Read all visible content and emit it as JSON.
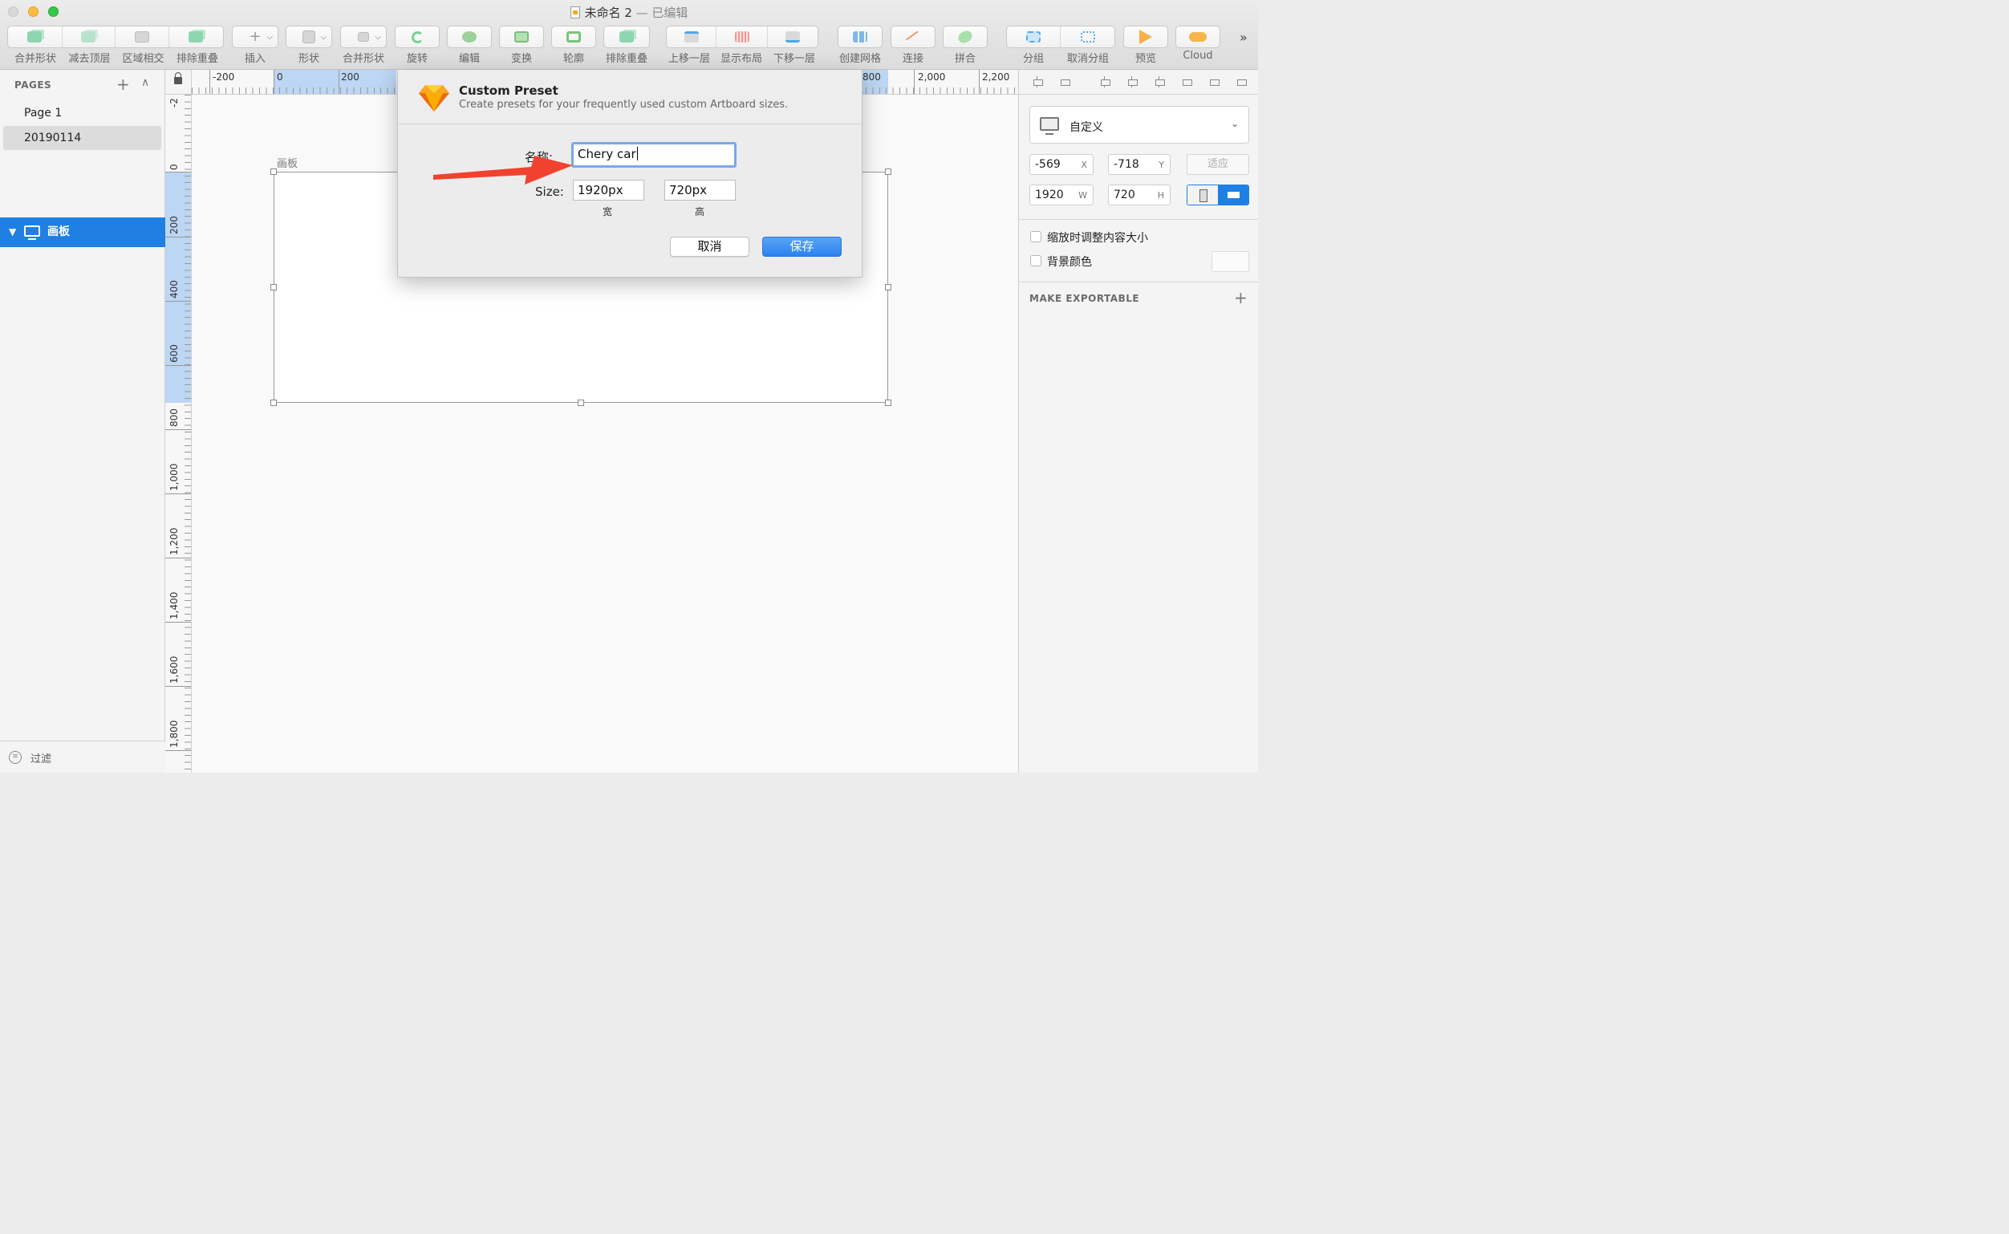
{
  "window": {
    "title": "未命名 2",
    "title_suffix": "— 已编辑"
  },
  "toolbar": {
    "labels": [
      "合并形状",
      "减去顶层",
      "区域相交",
      "排除重叠",
      "插入",
      "形状",
      "合并形状",
      "旋转",
      "编辑",
      "变换",
      "轮廓",
      "排除重叠",
      "上移一层",
      "显示布局",
      "下移一层",
      "创建网格",
      "连接",
      "拼合",
      "分组",
      "取消分组",
      "预览",
      "Cloud"
    ],
    "more": "»",
    "insert_glyph": "+"
  },
  "sidebar": {
    "pages_header": "PAGES",
    "add_glyph": "+",
    "collapse_glyph": "∧",
    "pages": [
      "Page 1",
      "20190114"
    ],
    "layer": {
      "name": "画板",
      "expand_glyph": "▼"
    },
    "filter_label": "过滤",
    "filter_glyph": "≡"
  },
  "ruler": {
    "h_labels": [
      "-200",
      "0",
      "200",
      "800",
      "2,000",
      "2,200"
    ],
    "v_labels": [
      "-2",
      "0",
      "200",
      "400",
      "600",
      "800",
      "1,000",
      "1,200",
      "1,400",
      "1,600",
      "1,800"
    ]
  },
  "canvas": {
    "artboard_label": "画板"
  },
  "inspector": {
    "preset": "自定义",
    "chevron": "⌄",
    "x": "-569",
    "x_unit": "X",
    "y": "-718",
    "y_unit": "Y",
    "w": "1920",
    "w_unit": "W",
    "h": "720",
    "h_unit": "H",
    "fit_label": "适应",
    "resize_content_label": "缩放时调整内容大小",
    "bg_color_label": "背景颜色",
    "make_exportable": "MAKE EXPORTABLE",
    "add_glyph": "+"
  },
  "dialog": {
    "title": "Custom Preset",
    "subtitle": "Create presets for your frequently used custom Artboard sizes.",
    "name_label": "名称:",
    "name_value": "Chery car",
    "size_label": "Size:",
    "width_value": "1920px",
    "height_value": "720px",
    "width_caption": "宽",
    "height_caption": "高",
    "cancel_label": "取消",
    "save_label": "保存"
  },
  "colors": {
    "accent": "#1f7fe3",
    "arrow": "#f0422f",
    "traffic_min": "#fdbc40",
    "traffic_max": "#34c749",
    "sketch_logo": "#f7a823"
  }
}
